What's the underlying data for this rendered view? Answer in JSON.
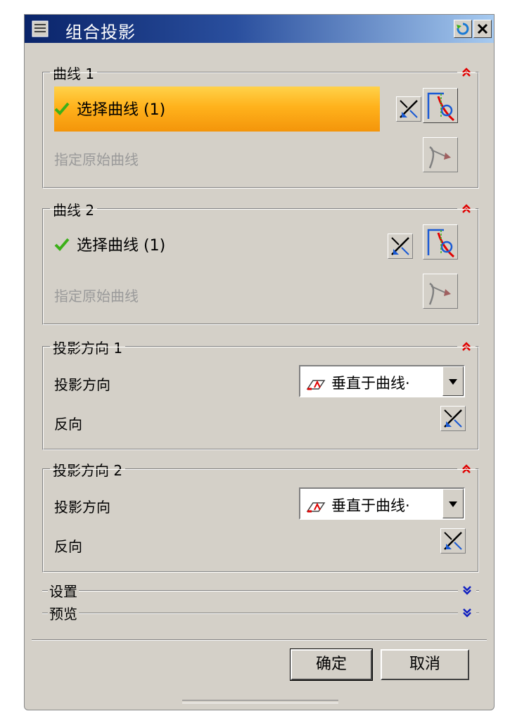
{
  "window": {
    "title": "组合投影"
  },
  "curve1": {
    "legend": "曲线 1",
    "select_label": "选择曲线 (1)",
    "original_label": "指定原始曲线"
  },
  "curve2": {
    "legend": "曲线 2",
    "select_label": "选择曲线 (1)",
    "original_label": "指定原始曲线"
  },
  "proj1": {
    "legend": "投影方向 1",
    "direction_label": "投影方向",
    "direction_value": "垂直于曲线·",
    "reverse_label": "反向"
  },
  "proj2": {
    "legend": "投影方向 2",
    "direction_label": "投影方向",
    "direction_value": "垂直于曲线·",
    "reverse_label": "反向"
  },
  "settings": {
    "label": "设置"
  },
  "preview": {
    "label": "预览"
  },
  "buttons": {
    "ok": "确定",
    "cancel": "取消"
  },
  "colors": {
    "accent_highlight": "#f7a010",
    "check_green": "#3cb019",
    "title_bar": "#0a246a",
    "collapse_arrow": "#e00000",
    "expand_arrow": "#1020c0"
  }
}
